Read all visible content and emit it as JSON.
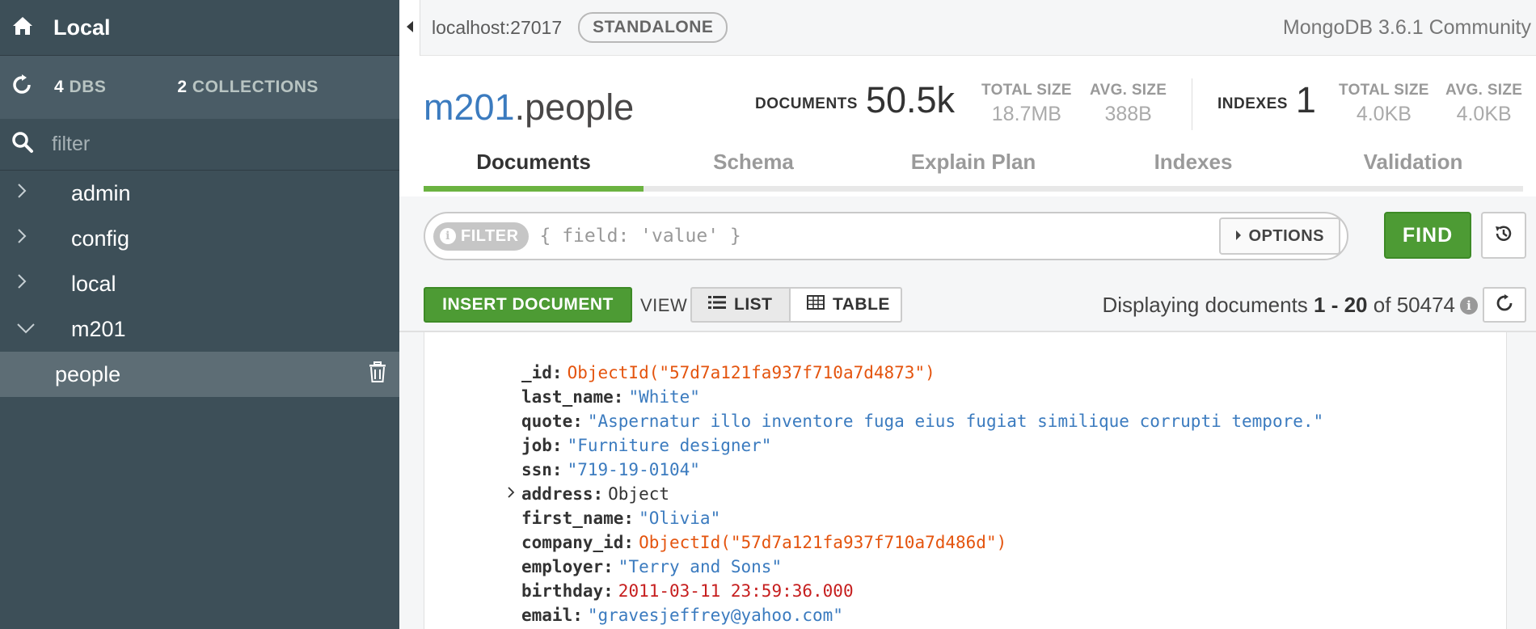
{
  "sidebar": {
    "title": "Local",
    "dbs_count": "4",
    "dbs_label": "DBS",
    "collections_count": "2",
    "collections_label": "COLLECTIONS",
    "filter_placeholder": "filter",
    "databases": [
      {
        "name": "admin",
        "expanded": false
      },
      {
        "name": "config",
        "expanded": false
      },
      {
        "name": "local",
        "expanded": false
      },
      {
        "name": "m201",
        "expanded": true
      }
    ],
    "active_collection": "people"
  },
  "topbar": {
    "host": "localhost:27017",
    "badge": "STANDALONE",
    "version": "MongoDB 3.6.1 Community"
  },
  "collection": {
    "db": "m201",
    "name": ".people",
    "documents_label": "DOCUMENTS",
    "documents_value": "50.5k",
    "doc_total_size_label": "TOTAL SIZE",
    "doc_total_size": "18.7MB",
    "doc_avg_size_label": "AVG. SIZE",
    "doc_avg_size": "388B",
    "indexes_label": "INDEXES",
    "indexes_value": "1",
    "idx_total_size_label": "TOTAL SIZE",
    "idx_total_size": "4.0KB",
    "idx_avg_size_label": "AVG. SIZE",
    "idx_avg_size": "4.0KB"
  },
  "tabs": [
    {
      "label": "Documents",
      "active": true
    },
    {
      "label": "Schema",
      "active": false
    },
    {
      "label": "Explain Plan",
      "active": false
    },
    {
      "label": "Indexes",
      "active": false
    },
    {
      "label": "Validation",
      "active": false
    }
  ],
  "query": {
    "filter_label": "FILTER",
    "filter_placeholder": "{ field: 'value' }",
    "options_label": "OPTIONS",
    "find_label": "FIND"
  },
  "toolbar": {
    "insert_label": "INSERT DOCUMENT",
    "view_label": "VIEW",
    "list_label": "LIST",
    "table_label": "TABLE",
    "display_prefix": "Displaying documents",
    "display_range": "1 - 20",
    "display_of": "of",
    "display_total": "50474"
  },
  "document": {
    "fields": [
      {
        "key": "_id:",
        "value": "ObjectId(\"57d7a121fa937f710a7d4873\")",
        "type": "oid"
      },
      {
        "key": "last_name:",
        "value": "\"White\"",
        "type": "str"
      },
      {
        "key": "quote:",
        "value": "\"Aspernatur illo inventore fuga eius fugiat similique corrupti tempore.\"",
        "type": "str"
      },
      {
        "key": "job:",
        "value": "\"Furniture designer\"",
        "type": "str"
      },
      {
        "key": "ssn:",
        "value": "\"719-19-0104\"",
        "type": "str"
      },
      {
        "key": "address:",
        "value": "Object",
        "type": "obj",
        "expandable": true
      },
      {
        "key": "first_name:",
        "value": "\"Olivia\"",
        "type": "str"
      },
      {
        "key": "company_id:",
        "value": "ObjectId(\"57d7a121fa937f710a7d486d\")",
        "type": "oid"
      },
      {
        "key": "employer:",
        "value": "\"Terry and Sons\"",
        "type": "str"
      },
      {
        "key": "birthday:",
        "value": "2011-03-11 23:59:36.000",
        "type": "date"
      },
      {
        "key": "email:",
        "value": "\"gravesjeffrey@yahoo.com\"",
        "type": "str"
      }
    ]
  },
  "colors": {
    "sidebar_bg": "#3d4f58",
    "accent_green": "#4d9b34",
    "db_blue": "#3b7bbf",
    "objectid_orange": "#e4540e",
    "date_red": "#c61e1e"
  }
}
